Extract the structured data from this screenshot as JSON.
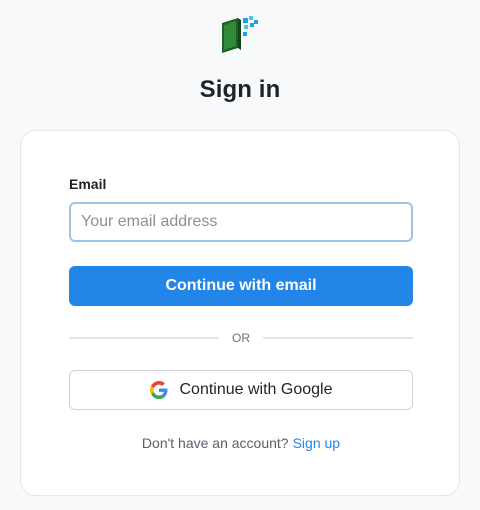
{
  "page": {
    "title": "Sign in"
  },
  "form": {
    "email_label": "Email",
    "email_placeholder": "Your email address",
    "email_value": "",
    "continue_email_label": "Continue with email",
    "divider_text": "OR",
    "continue_google_label": "Continue with Google",
    "signup_prompt": "Don't have an account?",
    "signup_link": "Sign up"
  },
  "icons": {
    "logo": "app-logo-icon",
    "google": "google-icon"
  },
  "colors": {
    "primary": "#2186e8",
    "logo_green": "#1f6b2a",
    "logo_cyan": "#1aa3e0"
  }
}
